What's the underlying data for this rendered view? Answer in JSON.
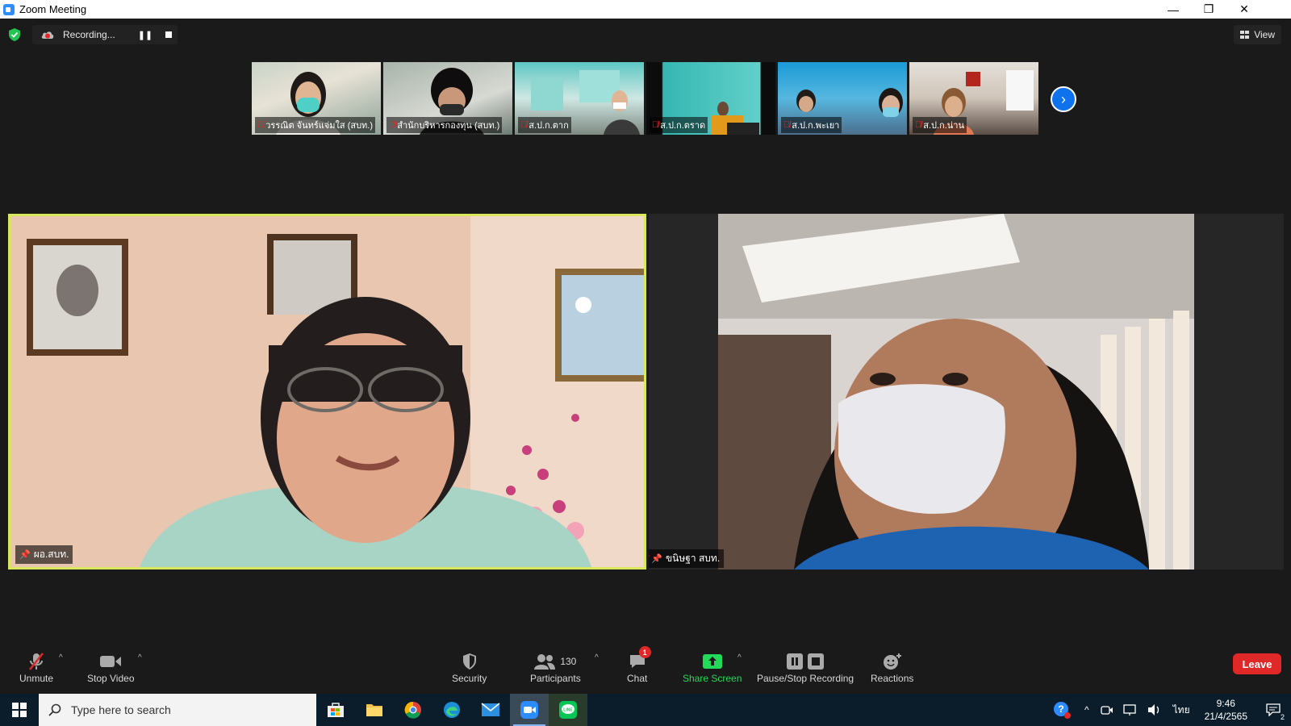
{
  "window": {
    "title": "Zoom Meeting",
    "minimize": "—",
    "restore": "❐",
    "close": "✕"
  },
  "top": {
    "recording_label": "Recording...",
    "view_label": "View"
  },
  "thumbnails": [
    {
      "name": "วรรณิต จันทร์แจ่มใส (สบท.)"
    },
    {
      "name": "สำนักบริหารกองทุน (สบท.)"
    },
    {
      "name": "ส.ป.ก.ตาก"
    },
    {
      "name": "ส.ป.ก.ตราด"
    },
    {
      "name": "ส.ป.ก.พะเยา"
    },
    {
      "name": "ส.ป.ก.น่าน"
    }
  ],
  "tiles": {
    "left_name": "ผอ.สบท.",
    "right_name": "ขนิษฐา สบท."
  },
  "toolbar": {
    "unmute": "Unmute",
    "stop_video": "Stop Video",
    "security": "Security",
    "participants": "Participants",
    "participants_count": "130",
    "chat": "Chat",
    "chat_badge": "1",
    "share_screen": "Share Screen",
    "pause_stop_recording": "Pause/Stop Recording",
    "reactions": "Reactions",
    "leave": "Leave"
  },
  "taskbar": {
    "search_placeholder": "Type here to search",
    "language": "ไทย",
    "time": "9:46",
    "date": "21/4/2565",
    "notification_count": "2"
  },
  "colors": {
    "accent_blue": "#0e72ed",
    "share_green": "#23d959",
    "leave_red": "#e02828",
    "active_speaker_border": "#d9e85a"
  }
}
